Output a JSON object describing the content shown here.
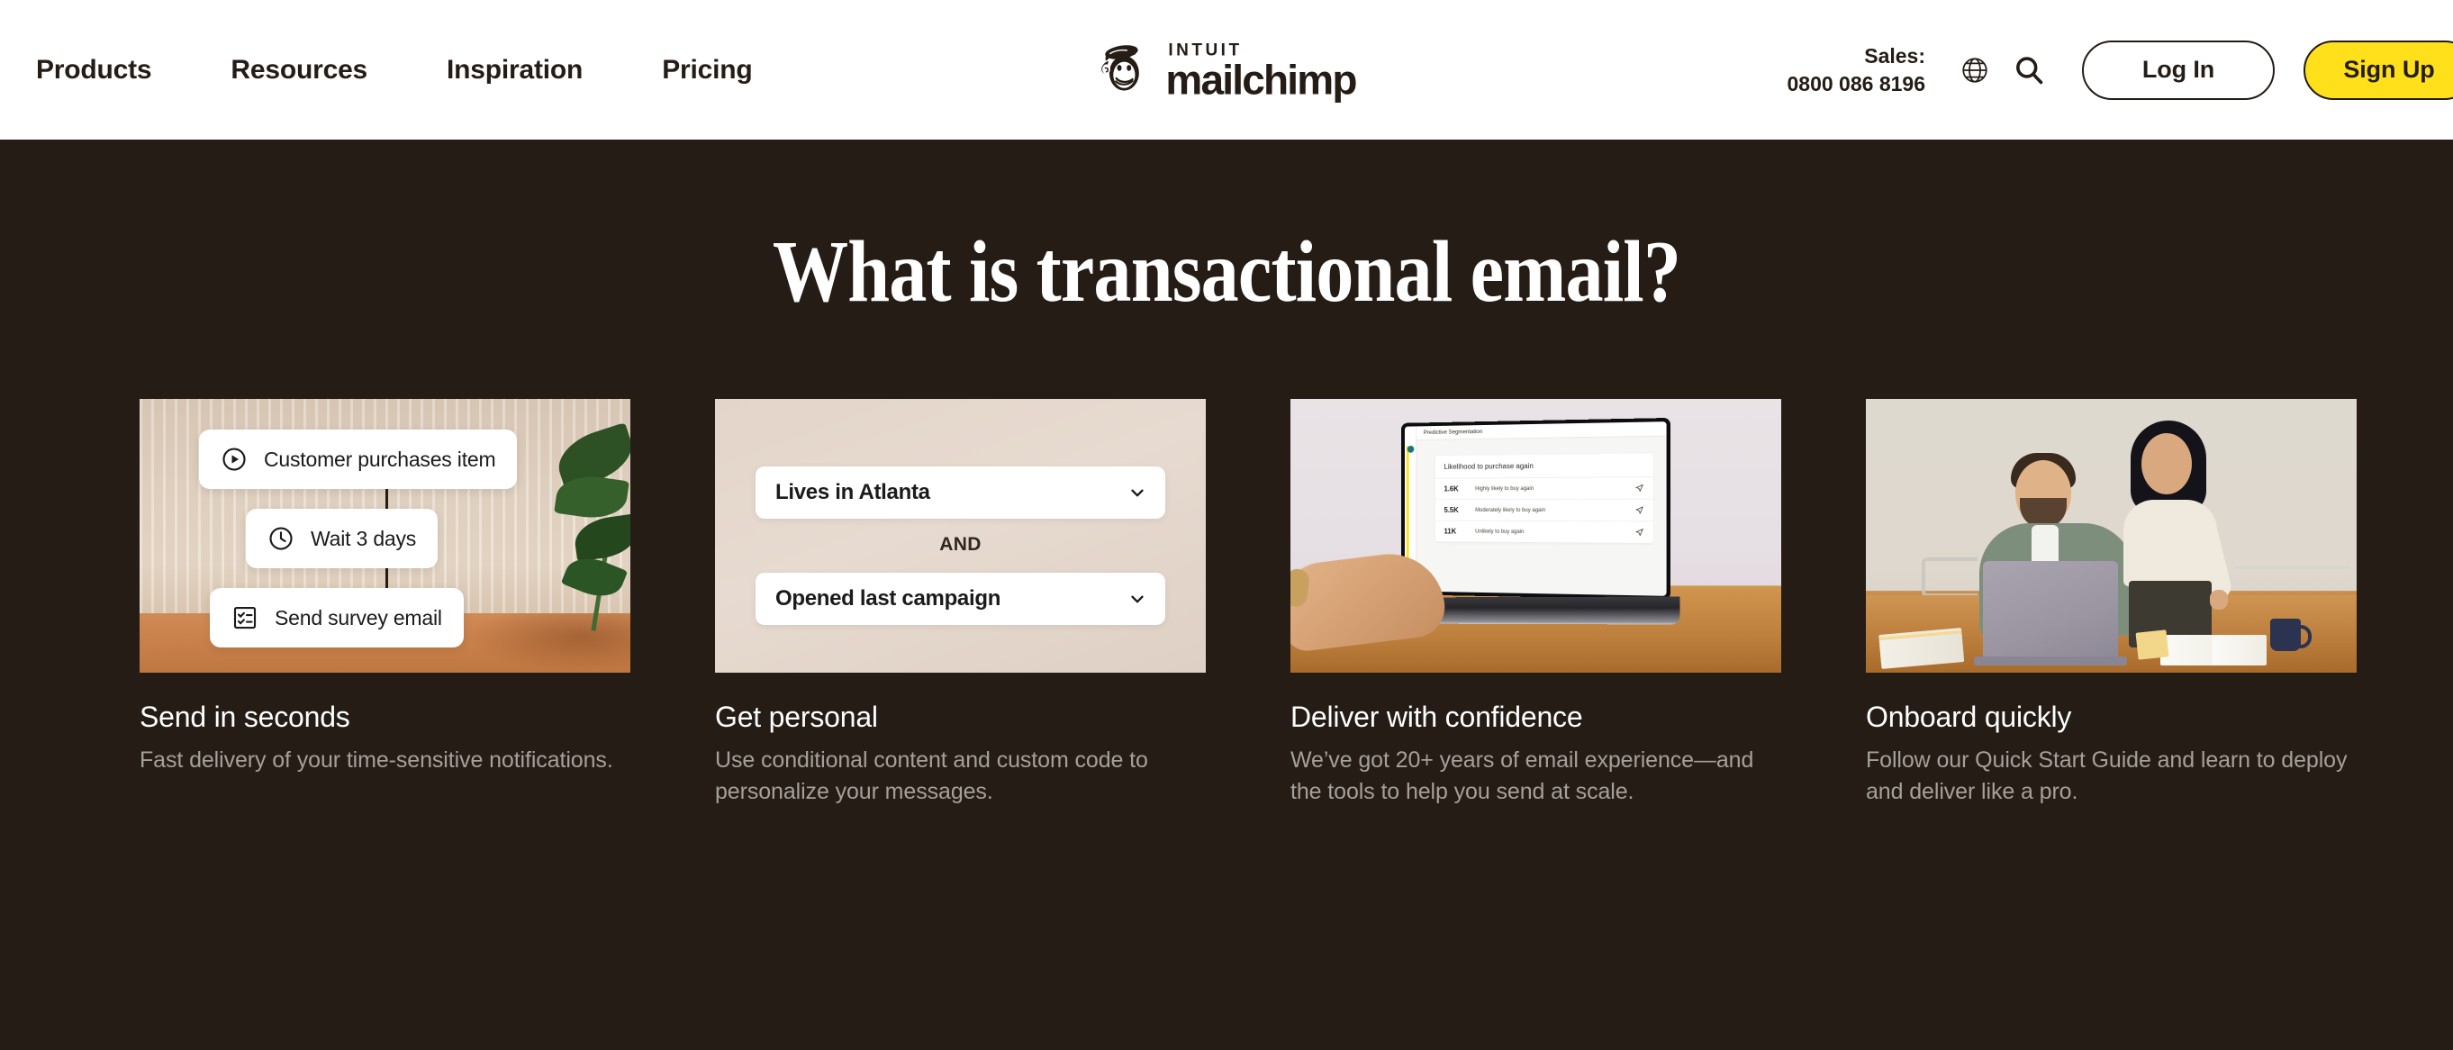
{
  "header": {
    "nav": [
      {
        "label": "Products"
      },
      {
        "label": "Resources"
      },
      {
        "label": "Inspiration"
      },
      {
        "label": "Pricing"
      }
    ],
    "logo": {
      "intuit": "INTUIT",
      "mailchimp": "mailchimp"
    },
    "sales": {
      "label": "Sales:",
      "phone": "0800 086 8196"
    },
    "icons": {
      "language": "globe-icon",
      "search": "search-icon"
    },
    "login_label": "Log In",
    "signup_label": "Sign Up"
  },
  "section": {
    "title": "What is transactional email?",
    "background_color": "#241c15",
    "accent_color": "#ffe01b"
  },
  "cards": [
    {
      "title": "Send in seconds",
      "desc": "Fast delivery of your time-sensitive notifications.",
      "media": {
        "kind": "automation-journey",
        "steps": [
          {
            "icon": "play-circle-icon",
            "label": "Customer purchases item"
          },
          {
            "icon": "clock-icon",
            "label": "Wait 3 days"
          },
          {
            "icon": "checklist-icon",
            "label": "Send survey email"
          }
        ]
      }
    },
    {
      "title": "Get personal",
      "desc": "Use conditional content and custom code to personalize your messages.",
      "media": {
        "kind": "segmentation-rules",
        "rules": [
          {
            "label": "Lives in Atlanta",
            "icon": "chevron-down-icon"
          },
          {
            "label": "Opened last campaign",
            "icon": "chevron-down-icon"
          }
        ],
        "operator": "AND"
      }
    },
    {
      "title": "Deliver with confidence",
      "desc": "We’ve got 20+ years of email experience—and the tools to help you send at scale.",
      "media": {
        "kind": "laptop-dashboard",
        "app_title": "Predictive Segmentation",
        "panel_title": "Likelihood to purchase again",
        "rows": [
          {
            "value": "1.6K",
            "label": "Highly likely to buy again"
          },
          {
            "value": "5.5K",
            "label": "Moderately likely to buy again"
          },
          {
            "value": "11K",
            "label": "Unlikely to buy again"
          }
        ]
      }
    },
    {
      "title": "Onboard quickly",
      "desc": "Follow our Quick Start Guide and learn to deploy and deliver like a pro.",
      "media": {
        "kind": "team-photo"
      }
    }
  ]
}
